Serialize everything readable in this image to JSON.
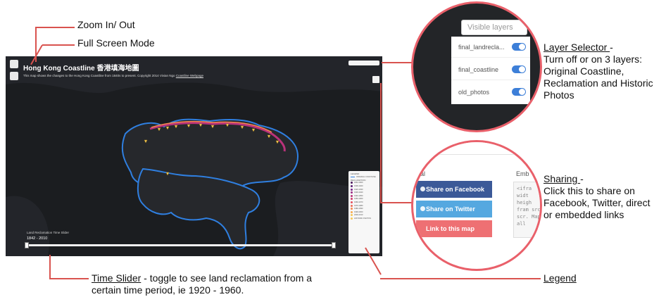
{
  "callouts": {
    "zoom": "Zoom In/ Out",
    "fullscreen": "Full Screen Mode",
    "layer_title": "Layer Selector ",
    "layer_dash": "-",
    "layer_desc": [
      "Turn off or on 3 layers:",
      "Original Coastline,",
      "Reclamation and Historic",
      "Photos"
    ],
    "sharing_title": "Sharing ",
    "sharing_dash": "-",
    "sharing_desc": [
      "Click this to share on",
      "Facebook, Twitter, direct",
      "or embedded links"
    ],
    "time_title": "Time Slider",
    "time_desc_1": " - toggle to see land reclamation from a",
    "time_desc_2": "certain time period, ie 1920 - 1960.",
    "legend": "Legend"
  },
  "map": {
    "title": "Hong Kong Coastline 香港填海地圖",
    "description": "This map shows the changes to the Hong Kong Coastline from 1840s to present. Copyright 2014 Vivian Ngo",
    "description_link": "Coastline Webpage",
    "slider_caption": "Land Reclamation Time Slider",
    "slider_range": "1842 - 2010",
    "slider_value_fraction": [
      0.0,
      1.0
    ],
    "legend_title": "LEGEND",
    "legend_subtitle": "ORIGINAL COASTLINE",
    "legend_group": "RECLAMATION",
    "legend_items": [
      {
        "label": "1842-1900",
        "color": "#4b1a5e"
      },
      {
        "label": "1900-1920",
        "color": "#5b1f74"
      },
      {
        "label": "1920-1930",
        "color": "#7a2589"
      },
      {
        "label": "1930-1940",
        "color": "#9b2b85"
      },
      {
        "label": "1940-1950",
        "color": "#b9327a"
      },
      {
        "label": "1950-1960",
        "color": "#d13c6c"
      },
      {
        "label": "1960-1970",
        "color": "#e44d5e"
      },
      {
        "label": "1970-1980",
        "color": "#ef6a55"
      },
      {
        "label": "1980-1990",
        "color": "#f5894f"
      },
      {
        "label": "1990-2000",
        "color": "#f7a84e"
      },
      {
        "label": "2000-2010",
        "color": "#f6c857"
      }
    ],
    "legend_photos": "HISTORIC PHOTOS",
    "coast_color": "#2f7fe0",
    "land_color": "#26282c",
    "sea_color": "#1b1d20"
  },
  "layers_panel": {
    "placeholder": "Visible layers",
    "layers": [
      {
        "name": "final_landrecla...",
        "on": true
      },
      {
        "name": "final_coastline",
        "on": true
      },
      {
        "name": "old_photos",
        "on": true
      }
    ],
    "toggle_color": "#3d7fd8"
  },
  "share_panel": {
    "left_heading": "al",
    "right_heading": "Emb",
    "facebook": "Share on Facebook",
    "twitter": "Share on Twitter",
    "link": "Link to this map",
    "embed_code": "<ifra widt heigh fram src= scr. Map all"
  }
}
